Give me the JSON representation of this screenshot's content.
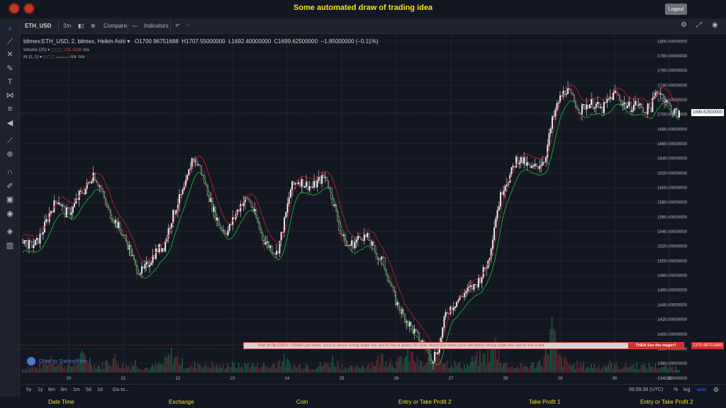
{
  "app": {
    "title": "Some automated draw of trading idea",
    "logout_label": "Logout"
  },
  "toolbar": {
    "symbol": "ETH_USD",
    "interval": "2m",
    "compare": "Compare",
    "indicators": "Indicators"
  },
  "legend": {
    "title": "bitmex:ETH_USD, 2, bitmex, Heikin Ashi ▾",
    "open": "O1700.96751688",
    "high": "H1707.55000000",
    "low": "L1692.40000000",
    "close": "C1699.62500000",
    "change": "−1.85000000 (−0.11%)",
    "volume_label": "Volume (20) ▾",
    "volume_value": "101.118K",
    "volume_na": "n/a",
    "ai_label": "AI (1, 1) ▾",
    "ai_na1": "n/a",
    "ai_na2": "n/a"
  },
  "banner": {
    "text": "Wait till flip ENDS  !    DRAW just when:  price is above strong angle line and AI line is green          OR          draw shorts just when price still below strong angle line and AI line is red",
    "end": "THEN See the magic!!"
  },
  "price_tag": "1699.62500000",
  "bottom_tag": "1370.98701888",
  "watermark": "Chart by TradingView",
  "bottombar": {
    "ranges": [
      "5y",
      "1y",
      "6m",
      "3m",
      "1m",
      "5d",
      "1d"
    ],
    "goto": "Go to...",
    "time": "05:59:36 (UTC)",
    "pct": "%",
    "log": "log",
    "auto": "auto"
  },
  "footer": [
    "Date Time",
    "Exchange",
    "Coin",
    "Entry or Take Profit 2",
    "Take Profit 1",
    "Entry or Take Profit 2"
  ],
  "chart_data": {
    "type": "candlestick",
    "y_ticks": [
      1800,
      1780,
      1760,
      1740,
      1720,
      1700,
      1680,
      1660,
      1640,
      1620,
      1600,
      1580,
      1560,
      1540,
      1520,
      1500,
      1480,
      1460,
      1440,
      1420,
      1400,
      1380,
      1360,
      1340
    ],
    "x_ticks": [
      "20",
      "21",
      "22",
      "23",
      "24",
      "25",
      "26",
      "27",
      "28",
      "29",
      "30",
      "31"
    ],
    "ylim": [
      1334,
      1808
    ],
    "price_path": [
      1530,
      1520,
      1525,
      1545,
      1570,
      1585,
      1565,
      1570,
      1590,
      1600,
      1620,
      1600,
      1570,
      1555,
      1540,
      1520,
      1490,
      1485,
      1500,
      1515,
      1520,
      1555,
      1580,
      1600,
      1640,
      1630,
      1600,
      1570,
      1545,
      1540,
      1560,
      1580,
      1585,
      1560,
      1530,
      1520,
      1510,
      1550,
      1600,
      1610,
      1605,
      1600,
      1610,
      1615,
      1580,
      1540,
      1520,
      1525,
      1535,
      1530,
      1510,
      1500,
      1470,
      1440,
      1425,
      1410,
      1395,
      1385,
      1365,
      1385,
      1430,
      1440,
      1450,
      1460,
      1465,
      1480,
      1500,
      1560,
      1600,
      1615,
      1640,
      1635,
      1625,
      1630,
      1640,
      1690,
      1720,
      1735,
      1720,
      1705,
      1715,
      1715,
      1705,
      1720,
      1730,
      1715,
      1710,
      1715,
      1705,
      1710,
      1735,
      1720,
      1705,
      1700
    ],
    "volume_path": [
      5,
      8,
      6,
      12,
      22,
      14,
      10,
      9,
      18,
      24,
      12,
      8,
      15,
      20,
      10,
      9,
      14,
      7,
      6,
      10,
      12,
      25,
      18,
      10,
      8,
      14,
      9,
      11,
      7,
      12,
      10,
      8,
      12,
      9,
      11,
      8,
      14,
      18,
      10,
      9,
      12,
      8,
      10,
      12,
      18,
      10,
      8,
      6,
      9,
      12,
      14,
      22,
      18,
      12,
      20,
      25,
      14,
      10,
      22,
      30,
      14,
      12,
      10,
      9,
      18,
      20,
      24,
      40,
      14,
      10,
      8,
      9,
      10,
      12,
      22,
      60,
      20,
      14,
      10,
      12,
      8,
      10,
      9,
      12,
      10,
      8,
      9,
      11,
      8,
      10,
      9,
      7,
      8,
      6
    ]
  }
}
